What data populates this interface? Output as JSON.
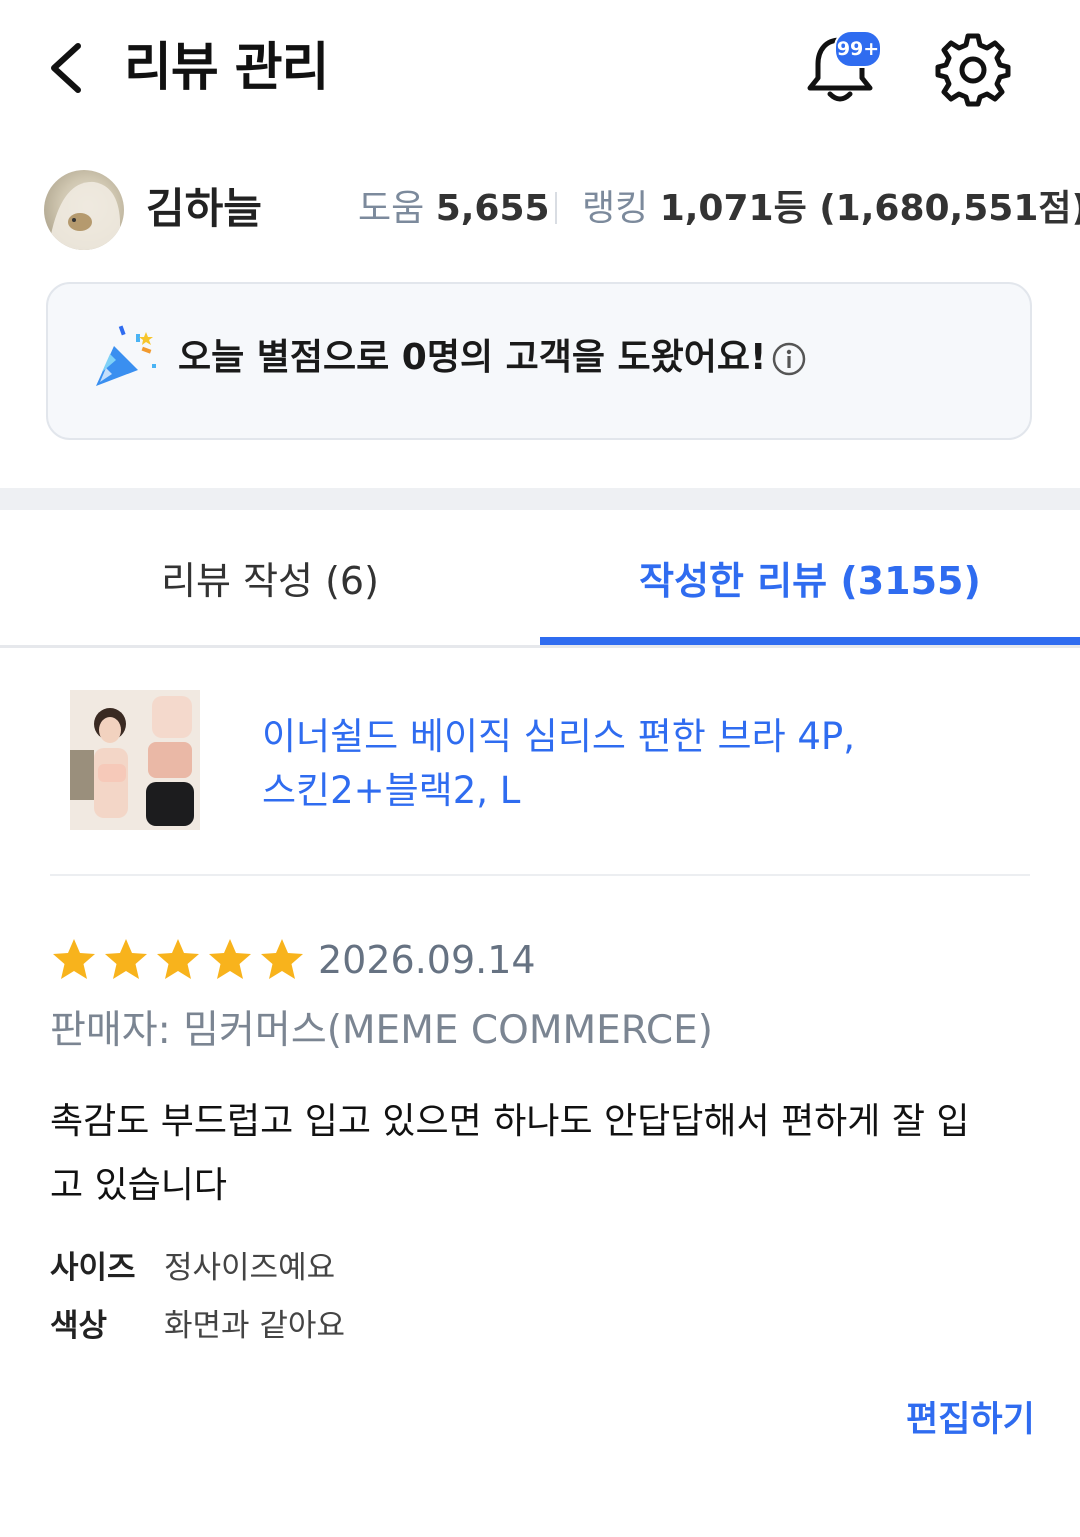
{
  "header": {
    "title": "리뷰 관리",
    "notification_badge": "99+"
  },
  "profile": {
    "name": "김하늘",
    "help_label": "도움",
    "help_count": "5,655",
    "rank_label": "랭킹",
    "rank_value": "1,071등 (1,680,551점)"
  },
  "banner": {
    "text": "오늘 별점으로 0명의 고객을 도왔어요!"
  },
  "tabs": [
    {
      "label": "리뷰 작성 (6)",
      "active": false
    },
    {
      "label": "작성한 리뷰 (3155)",
      "active": true
    }
  ],
  "review": {
    "product_name_line1": "이너쉴드 베이직 심리스 편한 브라 4P,",
    "product_name_line2": "스킨2+블랙2, L",
    "rating": 5,
    "max_rating": 5,
    "date": "2026.09.14",
    "seller": "판매자: 밈커머스(MEME COMMERCE)",
    "body": "촉감도 부드럽고 입고 있으면 하나도 안답답해서 편하게 잘 입고 있습니다",
    "options": [
      {
        "label": "사이즈",
        "value": "정사이즈예요"
      },
      {
        "label": "색상",
        "value": "화면과 같아요"
      }
    ],
    "edit_label": "편집하기"
  },
  "colors": {
    "accent": "#2f6cf0",
    "star": "#f8b31c"
  }
}
